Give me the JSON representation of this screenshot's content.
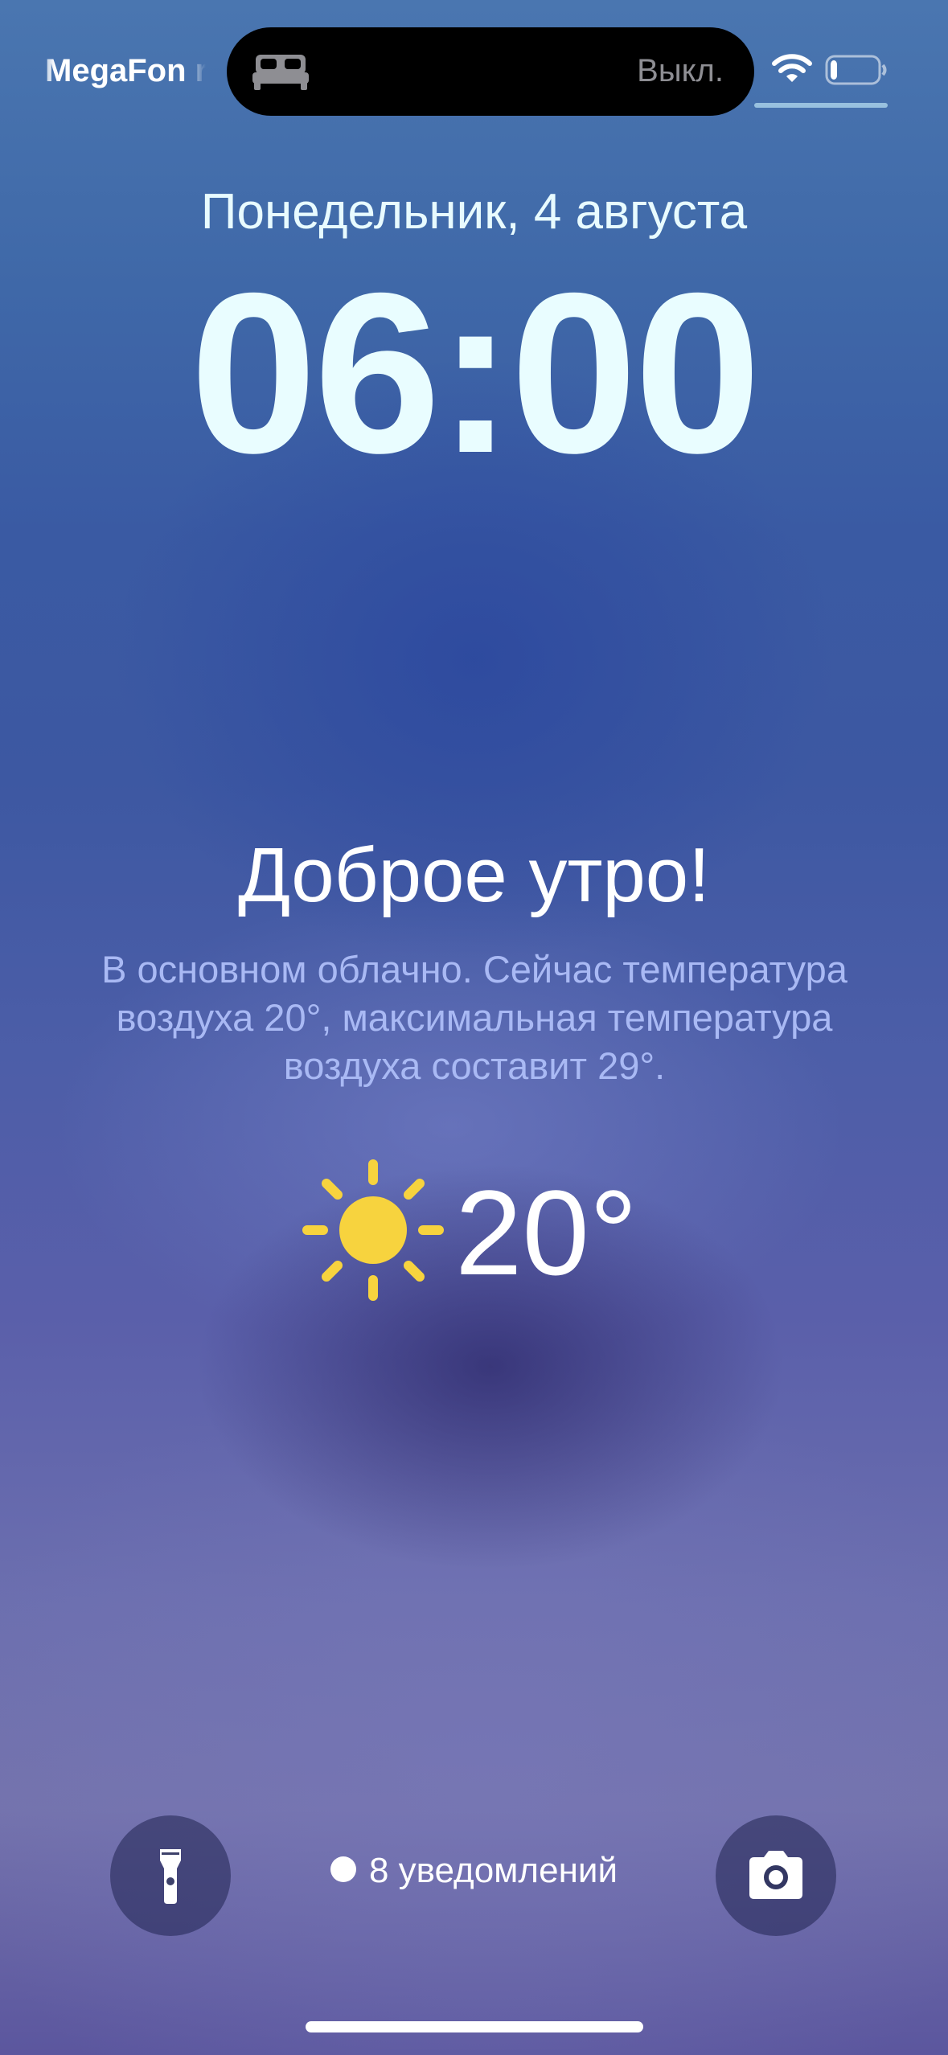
{
  "status_bar": {
    "carrier": "MegaFon r",
    "focus_mode_icon": "bed-icon",
    "focus_status": "Выкл.",
    "wifi_icon": "wifi-icon",
    "battery_icon": "battery-icon",
    "battery_level": 0.15
  },
  "lock_screen": {
    "date": "Понедельник, 4 августа",
    "time": "06:00"
  },
  "weather": {
    "greeting": "Доброе утро!",
    "summary": "В основном облачно. Сейчас температура воздуха 20°, максимальная температура воздуха составит 29°.",
    "condition_icon": "sun-icon",
    "temperature": "20°",
    "colors": {
      "sun": "#f7d33e",
      "summary_text": "#a9b9f4"
    }
  },
  "bottom": {
    "flashlight_icon": "flashlight-icon",
    "notifications_label": "8 уведомлений",
    "camera_icon": "camera-icon"
  }
}
